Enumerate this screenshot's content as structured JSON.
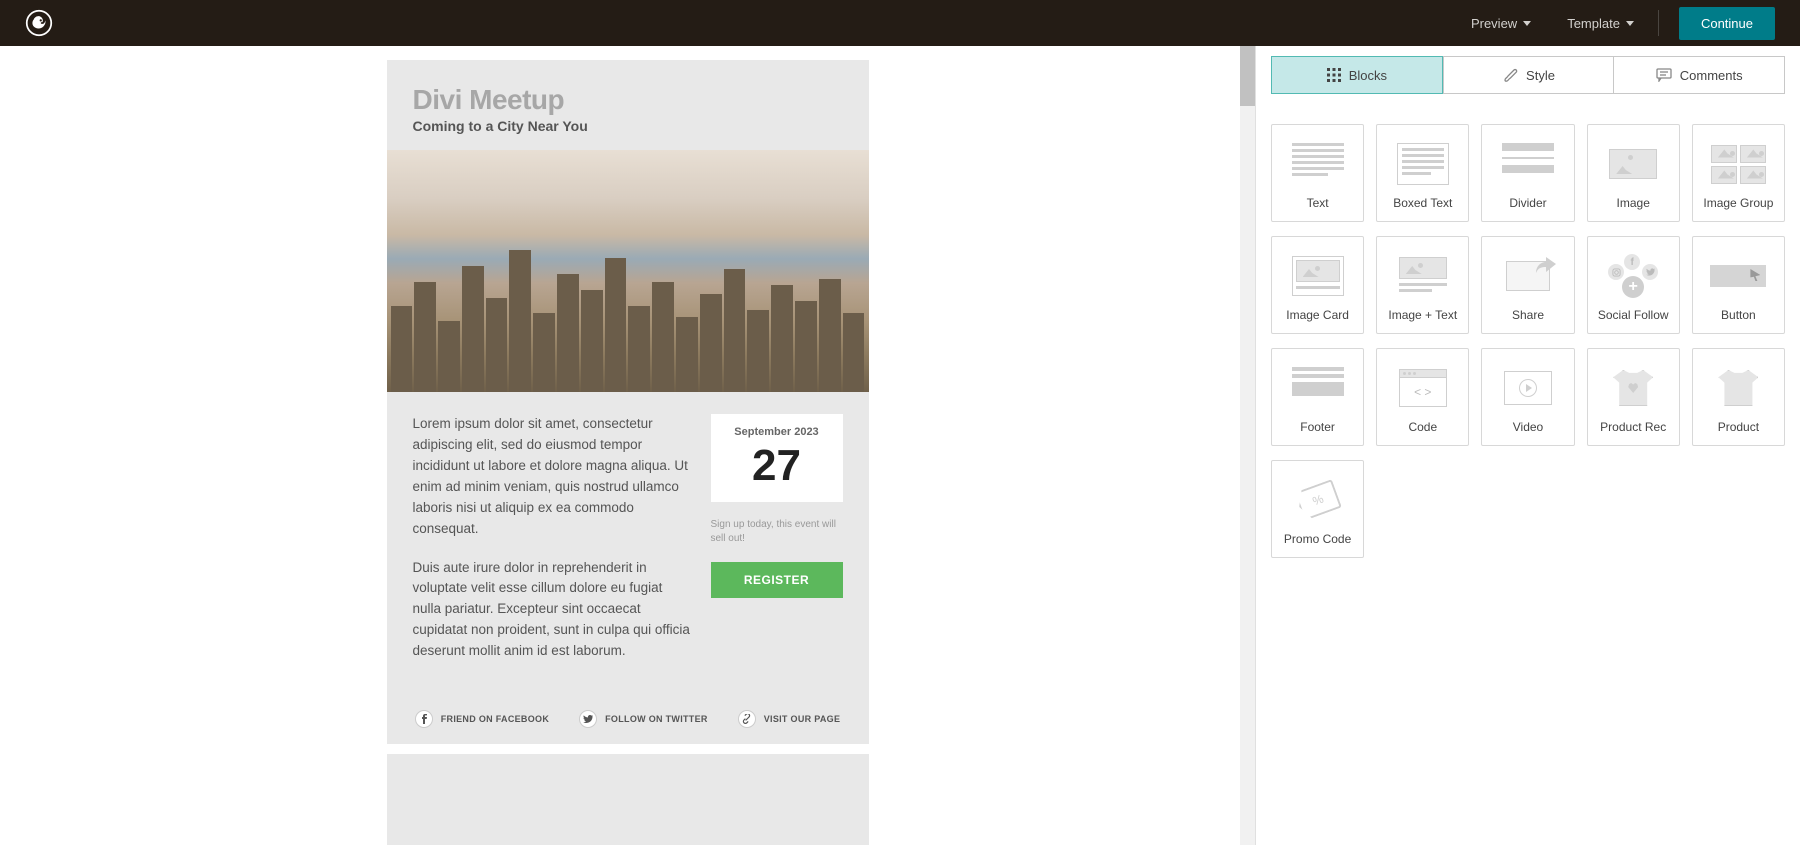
{
  "header": {
    "preview": "Preview",
    "template": "Template",
    "continue": "Continue"
  },
  "email": {
    "title": "Divi Meetup",
    "subtitle": "Coming to a City Near You",
    "paragraph1": "Lorem ipsum dolor sit amet, consectetur adipiscing elit, sed do eiusmod tempor incididunt ut labore et dolore magna aliqua. Ut enim ad minim veniam, quis nostrud ullamco laboris nisi ut aliquip ex ea commodo consequat.",
    "paragraph2": "Duis aute irure dolor in reprehenderit in voluptate velit esse cillum dolore eu fugiat nulla pariatur. Excepteur sint occaecat cupidatat non proident, sunt in culpa qui officia deserunt mollit anim id est laborum.",
    "event": {
      "month": "September 2023",
      "day": "27",
      "note": "Sign up today, this event will sell out!",
      "register": "REGISTER"
    },
    "social": {
      "facebook": "FRIEND ON FACEBOOK",
      "twitter": "FOLLOW ON TWITTER",
      "page": "VISIT OUR PAGE"
    }
  },
  "panel": {
    "tabs": {
      "blocks": "Blocks",
      "style": "Style",
      "comments": "Comments"
    },
    "blocks": [
      "Text",
      "Boxed Text",
      "Divider",
      "Image",
      "Image Group",
      "Image Card",
      "Image + Text",
      "Share",
      "Social Follow",
      "Button",
      "Footer",
      "Code",
      "Video",
      "Product Rec",
      "Product",
      "Promo Code"
    ]
  }
}
